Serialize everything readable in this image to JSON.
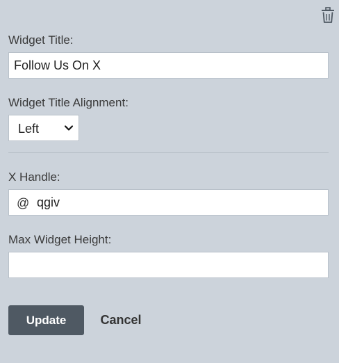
{
  "form": {
    "delete_icon": "trash-icon",
    "title_label": "Widget Title:",
    "title_value": "Follow Us On X",
    "alignment_label": "Widget Title Alignment:",
    "alignment_value": "Left",
    "handle_label": "X Handle:",
    "handle_prefix": "@",
    "handle_value": "qgiv",
    "height_label": "Max Widget Height:",
    "height_value": "",
    "update_label": "Update",
    "cancel_label": "Cancel"
  },
  "colors": {
    "background": "#ccd3db",
    "update_button": "#4f5963"
  }
}
